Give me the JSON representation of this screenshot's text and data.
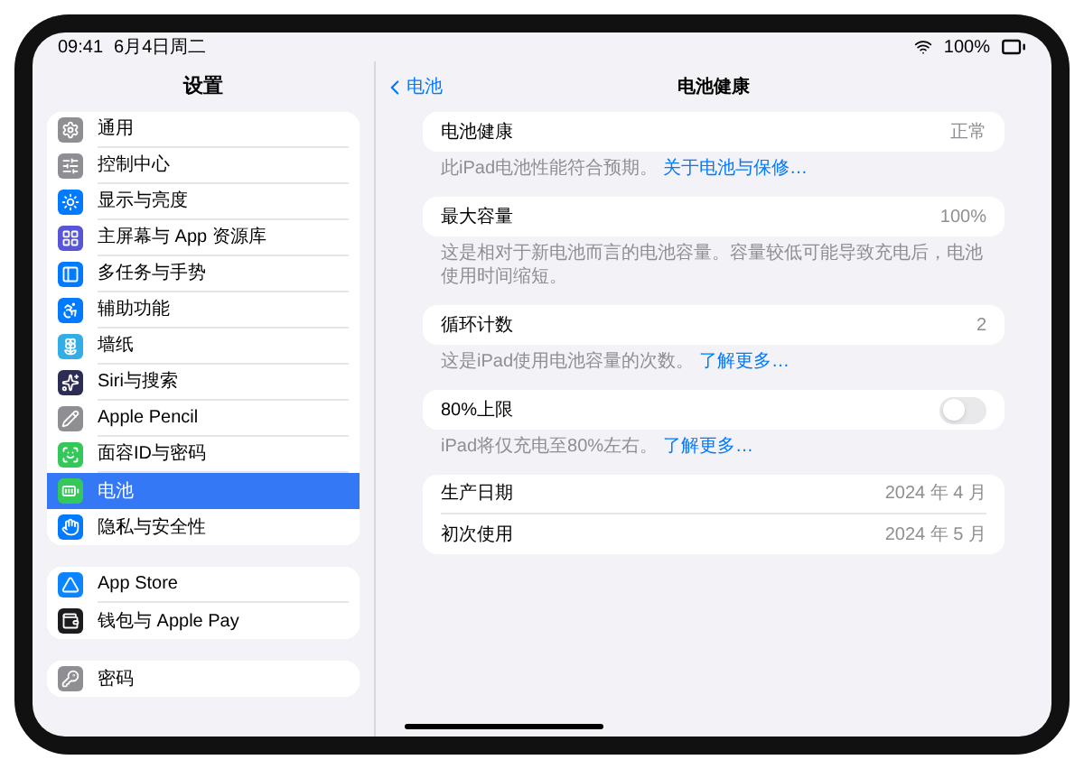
{
  "status_bar": {
    "time": "09:41",
    "date": "6月4日周二",
    "battery": "100%"
  },
  "sidebar": {
    "title": "设置",
    "groups": [
      {
        "items": [
          {
            "kind": "general",
            "label": "通用",
            "selected": false
          },
          {
            "kind": "control",
            "label": "控制中心",
            "selected": false
          },
          {
            "kind": "display",
            "label": "显示与亮度",
            "selected": false
          },
          {
            "kind": "home",
            "label": "主屏幕与 App 资源库",
            "selected": false
          },
          {
            "kind": "multitask",
            "label": "多任务与手势",
            "selected": false
          },
          {
            "kind": "accessibility",
            "label": "辅助功能",
            "selected": false
          },
          {
            "kind": "wallpaper",
            "label": "墙纸",
            "selected": false
          },
          {
            "kind": "siri",
            "label": "Siri与搜索",
            "selected": false
          },
          {
            "kind": "pencil",
            "label": "Apple Pencil",
            "selected": false
          },
          {
            "kind": "faceid",
            "label": "面容ID与密码",
            "selected": false
          },
          {
            "kind": "battery",
            "label": "电池",
            "selected": true
          },
          {
            "kind": "privacy",
            "label": "隐私与安全性",
            "selected": false
          }
        ]
      },
      {
        "items": [
          {
            "kind": "appstore",
            "label": "App Store",
            "selected": false
          },
          {
            "kind": "wallet",
            "label": "钱包与 Apple Pay",
            "selected": false
          }
        ]
      },
      {
        "items": [
          {
            "kind": "passwords",
            "label": "密码",
            "selected": false
          }
        ]
      }
    ]
  },
  "detail": {
    "back_label": "电池",
    "title": "电池健康",
    "sections": [
      {
        "rows": [
          {
            "kind": "value",
            "label": "电池健康",
            "value": "正常"
          }
        ],
        "footnote": {
          "text": "此iPad电池性能符合预期。",
          "link": "关于电池与保修…"
        }
      },
      {
        "rows": [
          {
            "kind": "value",
            "label": "最大容量",
            "value": "100%"
          }
        ],
        "footnote": {
          "text": "这是相对于新电池而言的电池容量。容量较低可能导致充电后，电池使用时间缩短。"
        }
      },
      {
        "rows": [
          {
            "kind": "value",
            "label": "循环计数",
            "value": "2"
          }
        ],
        "footnote": {
          "text": "这是iPad使用电池容量的次数。",
          "link": "了解更多…"
        }
      },
      {
        "rows": [
          {
            "kind": "toggle",
            "label": "80%上限",
            "on": false
          }
        ],
        "footnote": {
          "text": "iPad将仅充电至80%左右。",
          "link": "了解更多…"
        }
      },
      {
        "rows": [
          {
            "kind": "value",
            "label": "生产日期",
            "value": "2024 年 4 月"
          },
          {
            "kind": "value",
            "label": "初次使用",
            "value": "2024 年 5 月"
          }
        ]
      }
    ]
  }
}
